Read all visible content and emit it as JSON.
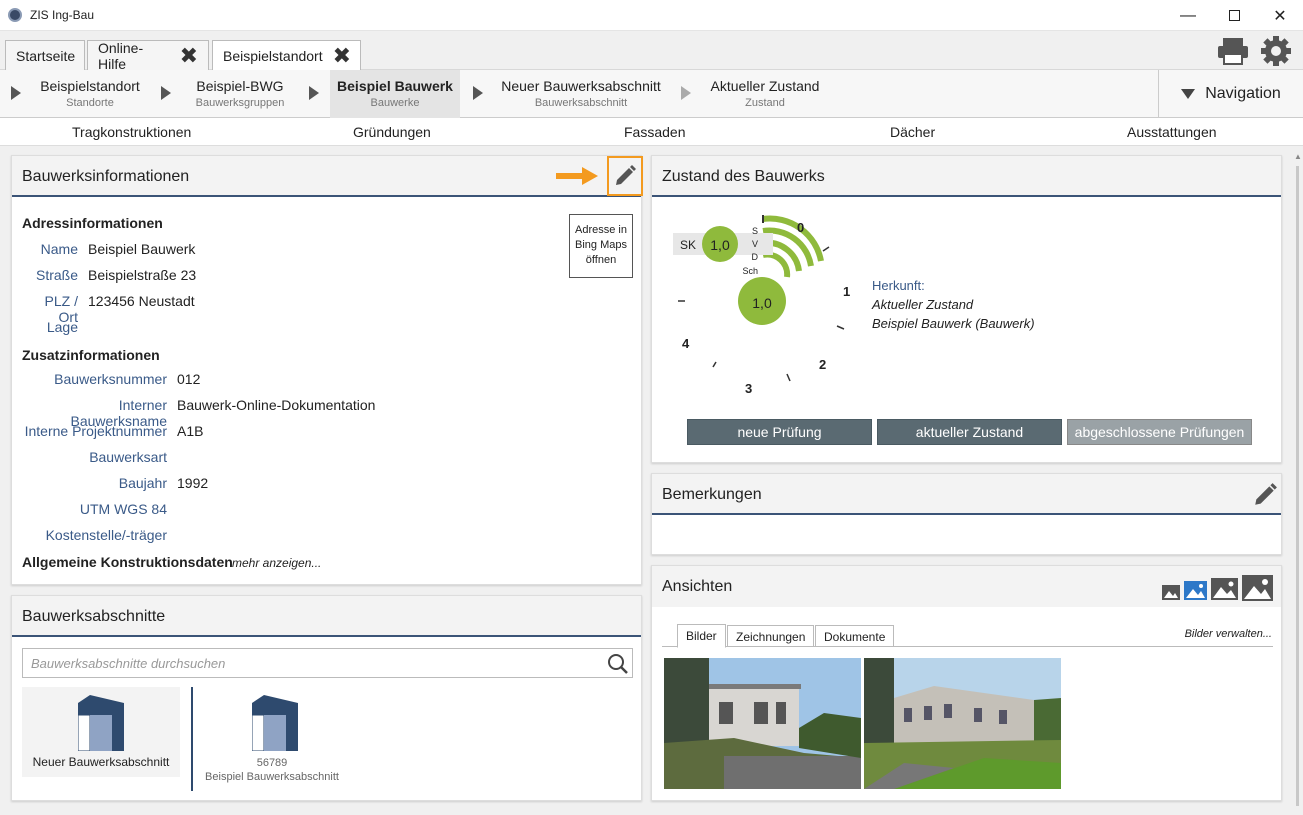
{
  "window": {
    "title": "ZIS Ing-Bau"
  },
  "tabs": [
    {
      "label": "Startseite"
    },
    {
      "label": "Online-Hilfe"
    },
    {
      "label": "Beispielstandort"
    }
  ],
  "breadcrumb": [
    {
      "title": "Beispielstandort",
      "sub": "Standorte"
    },
    {
      "title": "Beispiel-BWG",
      "sub": "Bauwerksgruppen"
    },
    {
      "title": "Beispiel Bauwerk",
      "sub": "Bauwerke"
    },
    {
      "title": "Neuer Bauwerksabschnitt",
      "sub": "Bauwerksabschnitt"
    },
    {
      "title": "Aktueller Zustand",
      "sub": "Zustand"
    }
  ],
  "navigation_label": "Navigation",
  "categories": [
    "Tragkonstruktionen",
    "Gründungen",
    "Fassaden",
    "Dächer",
    "Ausstattungen"
  ],
  "info": {
    "title": "Bauwerksinformationen",
    "map_button": "Adresse in Bing Maps öffnen",
    "address_heading": "Adressinformationen",
    "address": [
      {
        "label": "Name",
        "value": "Beispiel Bauwerk"
      },
      {
        "label": "Straße",
        "value": "Beispielstraße 23"
      },
      {
        "label": "PLZ / Ort",
        "value": "123456 Neustadt"
      },
      {
        "label": "Lage",
        "value": ""
      }
    ],
    "extra_heading": "Zusatzinformationen",
    "extra": [
      {
        "label": "Bauwerksnummer",
        "value": "012"
      },
      {
        "label": "Interner Bauwerksname",
        "value": "Bauwerk-Online-Dokumentation"
      },
      {
        "label": "Interne Projektnummer",
        "value": "A1B"
      },
      {
        "label": "Bauwerksart",
        "value": ""
      },
      {
        "label": "Baujahr",
        "value": "1992"
      },
      {
        "label": "UTM WGS 84",
        "value": ""
      },
      {
        "label": "Kostenstelle/-träger",
        "value": ""
      }
    ],
    "general_heading": "Allgemeine Konstruktionsdaten",
    "more_link": "mehr anzeigen..."
  },
  "sections": {
    "title": "Bauwerksabschnitte",
    "search_placeholder": "Bauwerksabschnitte durchsuchen",
    "items": [
      {
        "number": "",
        "name": "Neuer Bauwerksabschnitt"
      },
      {
        "number": "56789",
        "name": "Beispiel Bauwerksabschnitt"
      }
    ]
  },
  "condition": {
    "title": "Zustand des Bauwerks",
    "sk_label": "SK",
    "sk_value": "1,0",
    "main_value": "1,0",
    "bar_labels": [
      "S",
      "V",
      "D",
      "Sch"
    ],
    "scale": [
      "0",
      "1",
      "2",
      "3",
      "4"
    ],
    "origin_label": "Herkunft:",
    "origin_line1": "Aktueller Zustand",
    "origin_line2": "Beispiel Bauwerk (Bauwerk)",
    "buttons": [
      "neue Prüfung",
      "aktueller Zustand",
      "abgeschlossene Prüfungen"
    ],
    "accent": "#8fba3c"
  },
  "remarks": {
    "title": "Bemerkungen"
  },
  "views": {
    "title": "Ansichten",
    "tabs": [
      "Bilder",
      "Zeichnungen",
      "Dokumente"
    ],
    "manage_link": "Bilder verwalten..."
  }
}
